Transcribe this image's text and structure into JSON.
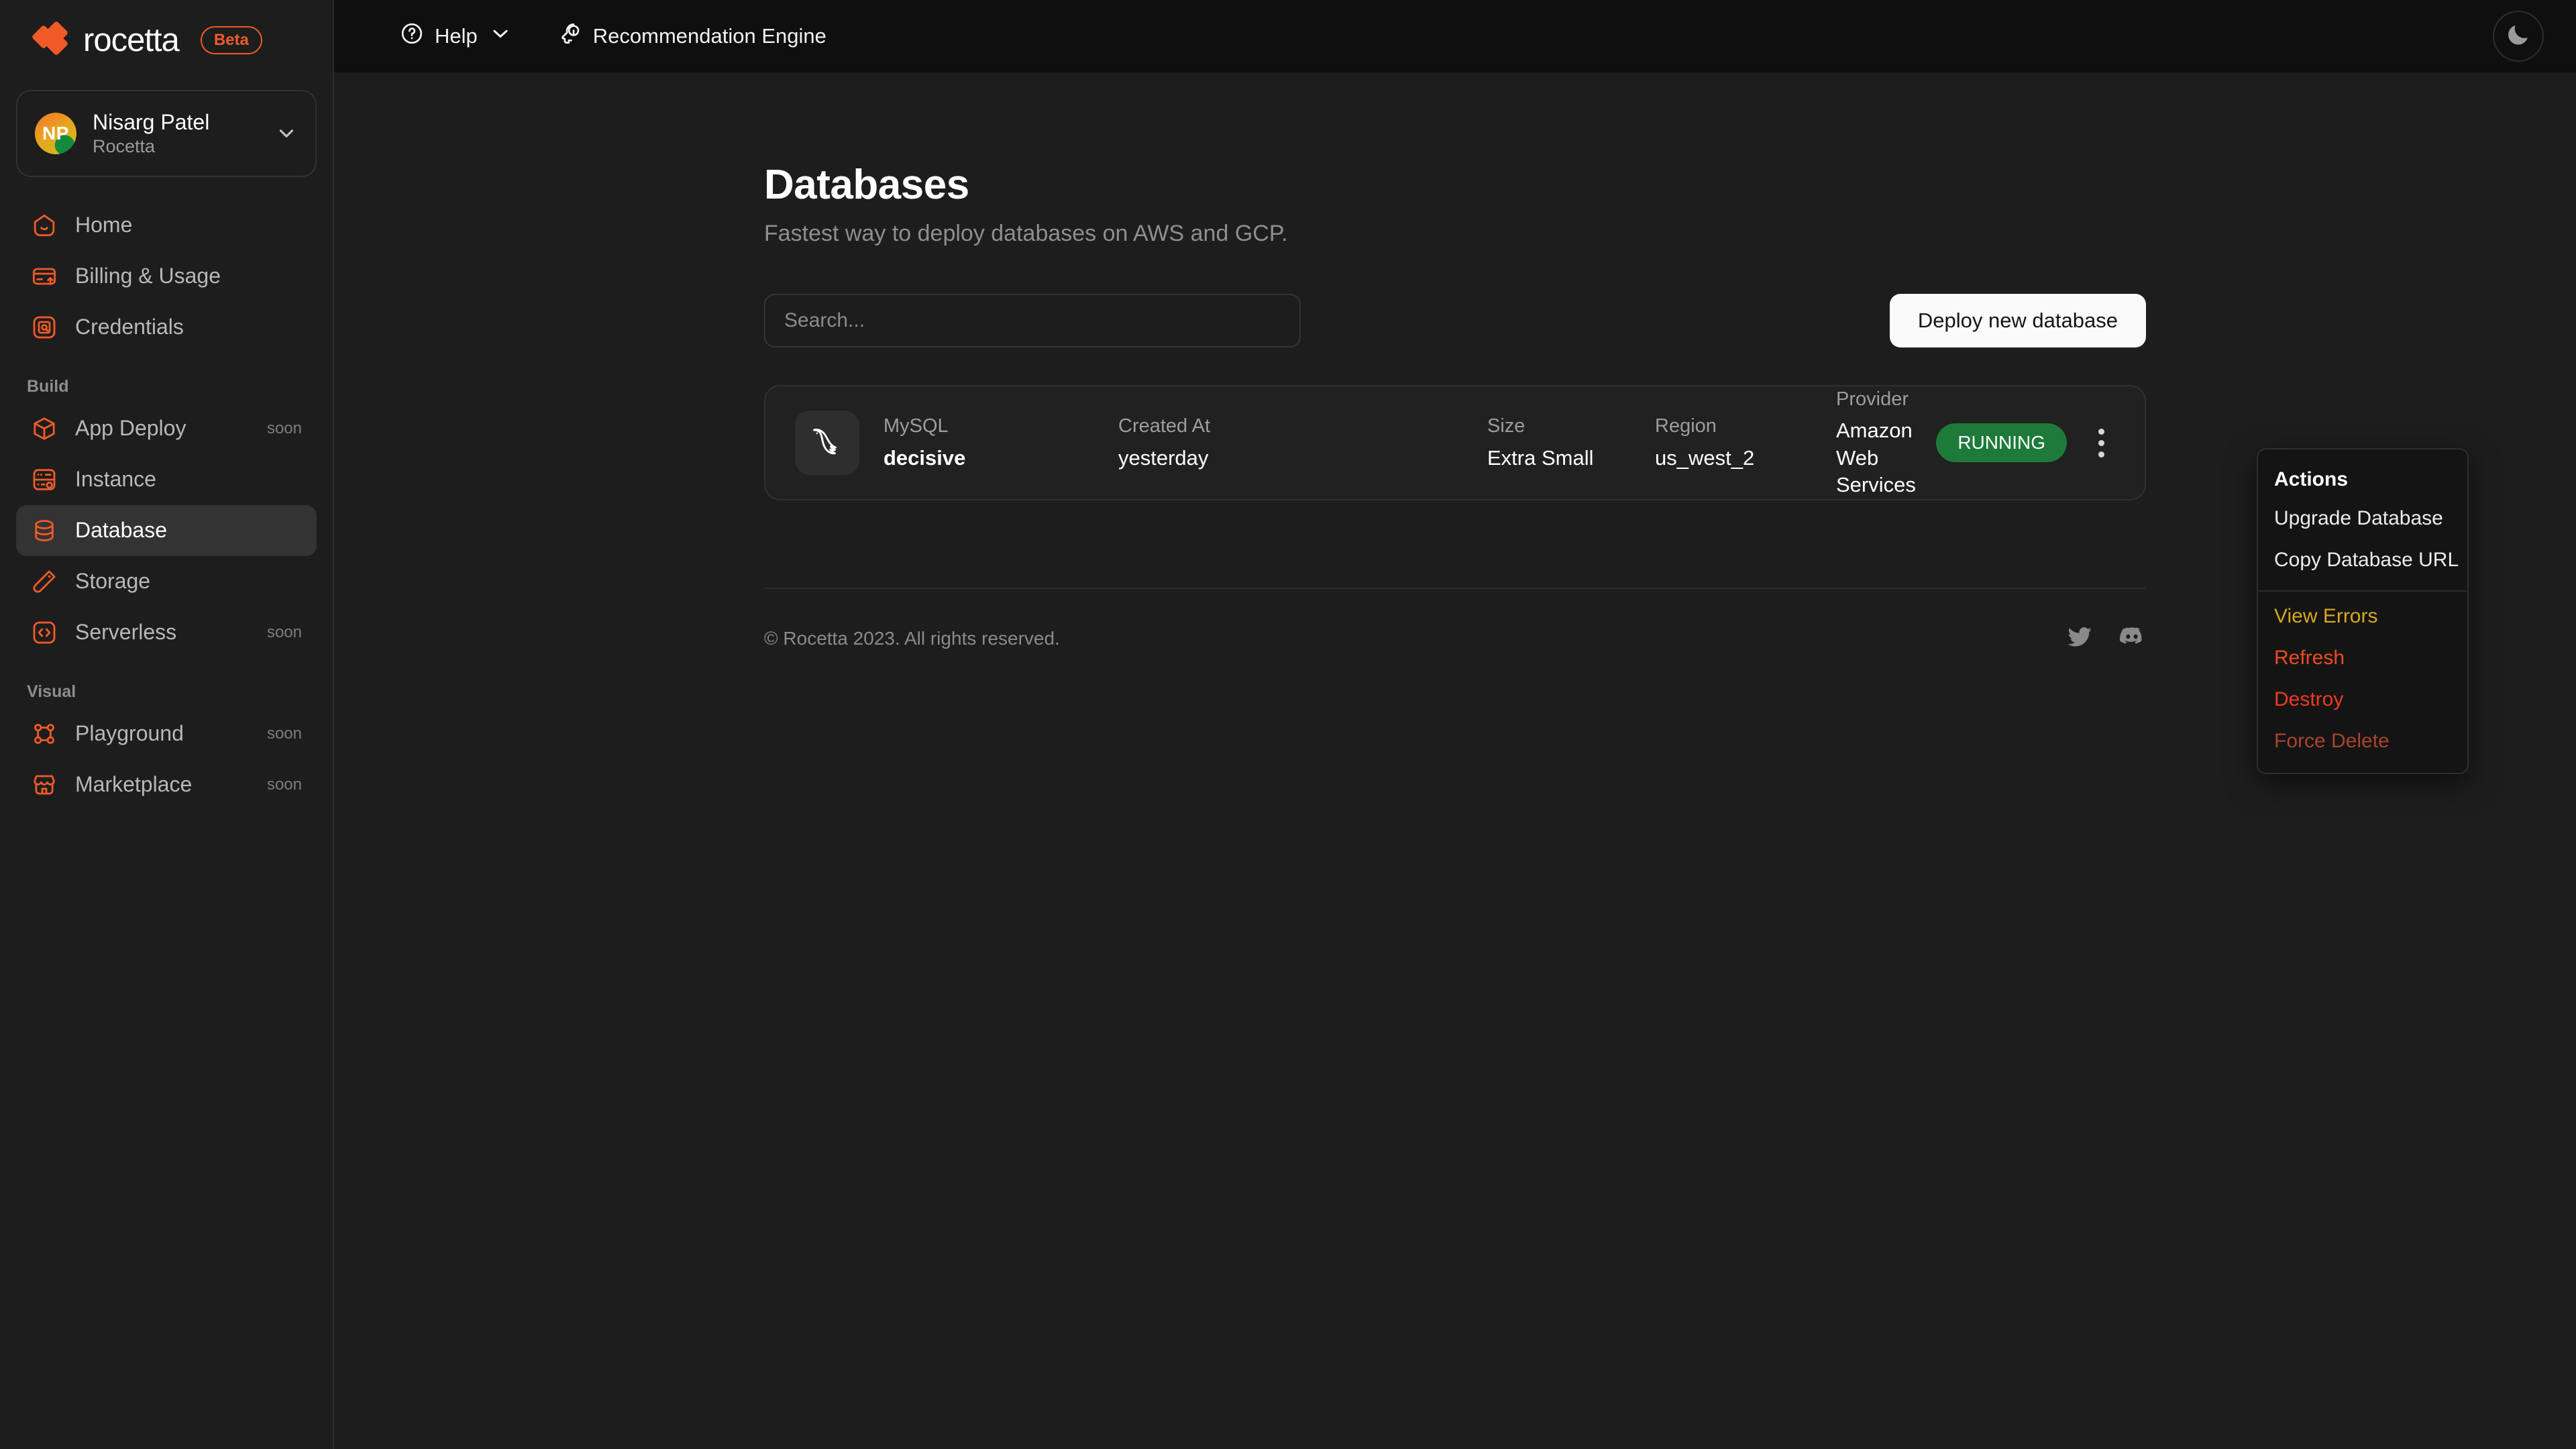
{
  "brand": {
    "name": "rocetta",
    "badge": "Beta",
    "accent": "#f05a28"
  },
  "account": {
    "initials": "NP",
    "name": "Nisarg Patel",
    "org": "Rocetta"
  },
  "sidebar": {
    "primary": [
      {
        "label": "Home",
        "icon": "home-icon",
        "badge": ""
      },
      {
        "label": "Billing & Usage",
        "icon": "billing-icon",
        "badge": ""
      },
      {
        "label": "Credentials",
        "icon": "credentials-icon",
        "badge": ""
      }
    ],
    "groups": [
      {
        "label": "Build",
        "items": [
          {
            "label": "App Deploy",
            "icon": "package-icon",
            "badge": "soon",
            "active": false
          },
          {
            "label": "Instance",
            "icon": "server-icon",
            "badge": "",
            "active": false
          },
          {
            "label": "Database",
            "icon": "database-icon",
            "badge": "",
            "active": true
          },
          {
            "label": "Storage",
            "icon": "storage-icon",
            "badge": "",
            "active": false
          },
          {
            "label": "Serverless",
            "icon": "code-icon",
            "badge": "soon",
            "active": false
          }
        ]
      },
      {
        "label": "Visual",
        "items": [
          {
            "label": "Playground",
            "icon": "playground-icon",
            "badge": "soon",
            "active": false
          },
          {
            "label": "Marketplace",
            "icon": "marketplace-icon",
            "badge": "soon",
            "active": false
          }
        ]
      }
    ]
  },
  "topbar": {
    "help_label": "Help",
    "recommendation_label": "Recommendation Engine",
    "theme_icon": "moon-icon"
  },
  "page": {
    "title": "Databases",
    "subtitle": "Fastest way to deploy databases on AWS and GCP.",
    "search_placeholder": "Search...",
    "search_value": "",
    "deploy_label": "Deploy new database"
  },
  "database_row": {
    "engine_label": "MySQL",
    "name": "decisive",
    "engine_icon": "mysql-dolphin-icon",
    "columns": [
      {
        "label": "Created At",
        "value": "yesterday"
      },
      {
        "label": "Size",
        "value": "Extra Small"
      },
      {
        "label": "Region",
        "value": "us_west_2"
      },
      {
        "label": "Provider",
        "value": "Amazon Web Services"
      }
    ],
    "status": "RUNNING",
    "status_color": "#1d7a38"
  },
  "actions_menu": {
    "heading": "Actions",
    "items": [
      {
        "label": "Upgrade Database",
        "tone": "default"
      },
      {
        "label": "Copy Database URL",
        "tone": "default"
      }
    ],
    "danger_items": [
      {
        "label": "View Errors",
        "tone": "warn"
      },
      {
        "label": "Refresh",
        "tone": "orange"
      },
      {
        "label": "Destroy",
        "tone": "danger"
      },
      {
        "label": "Force Delete",
        "tone": "muted"
      }
    ]
  },
  "footer": {
    "copyright": "© Rocetta 2023. All rights reserved.",
    "icons": [
      "twitter-icon",
      "discord-icon"
    ]
  }
}
